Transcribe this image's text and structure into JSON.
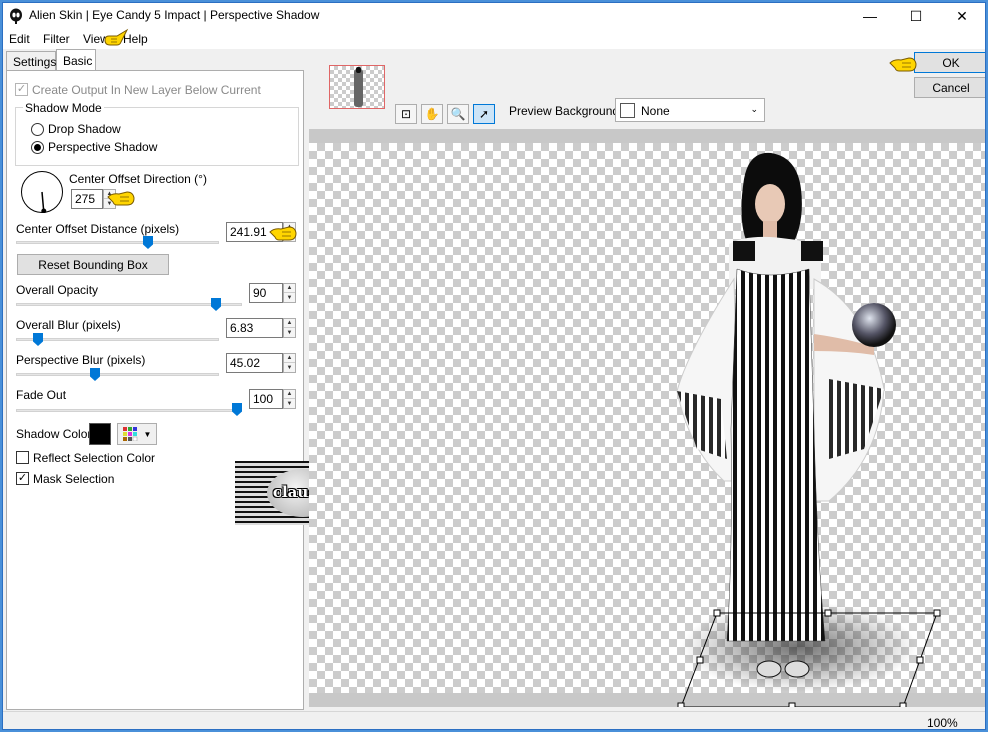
{
  "window": {
    "title": "Alien Skin | Eye Candy 5 Impact | Perspective Shadow",
    "controls": {
      "minimize": "—",
      "maximize": "☐",
      "close": "✕"
    },
    "icon": "alien-skin-logo-icon"
  },
  "menu": {
    "items": [
      "Edit",
      "Filter",
      "View",
      "Help"
    ]
  },
  "tabs": {
    "settings": "Settings",
    "basic": "Basic"
  },
  "basic": {
    "create_output_label": "Create Output In New Layer Below Current",
    "create_output_checked": true,
    "shadow_mode_label": "Shadow Mode",
    "shadow_modes": [
      "Drop Shadow",
      "Perspective Shadow"
    ],
    "shadow_mode_selected": "Perspective Shadow",
    "center_offset_direction_label": "Center Offset Direction (°)",
    "center_offset_direction_value": "275",
    "center_offset_distance_label": "Center Offset Distance (pixels)",
    "center_offset_distance_value": "241.91",
    "reset_bounding_box_label": "Reset Bounding Box",
    "overall_opacity_label": "Overall Opacity",
    "overall_opacity_value": "90",
    "overall_blur_label": "Overall Blur (pixels)",
    "overall_blur_value": "6.83",
    "perspective_blur_label": "Perspective Blur (pixels)",
    "perspective_blur_value": "45.02",
    "fade_out_label": "Fade Out",
    "fade_out_value": "100",
    "shadow_color_label": "Shadow Color",
    "shadow_color": "#000000",
    "reflect_selection_color_label": "Reflect Selection Color",
    "reflect_selection_color_checked": false,
    "mask_selection_label": "Mask Selection",
    "mask_selection_checked": true
  },
  "watermark": {
    "text": "claudia"
  },
  "preview_toolbar": {
    "preview_background_label": "Preview Background:",
    "preview_background_value": "None",
    "tools": [
      "bounding-box-tool-icon",
      "hand-tool-icon",
      "zoom-tool-icon",
      "pointer-tool-icon"
    ]
  },
  "buttons": {
    "ok": "OK",
    "cancel": "Cancel"
  },
  "status": {
    "zoom": "100%"
  },
  "colors": {
    "accent": "#0078d7",
    "pointer_hand": "#ffd500",
    "thumb_border": "#e06666"
  }
}
